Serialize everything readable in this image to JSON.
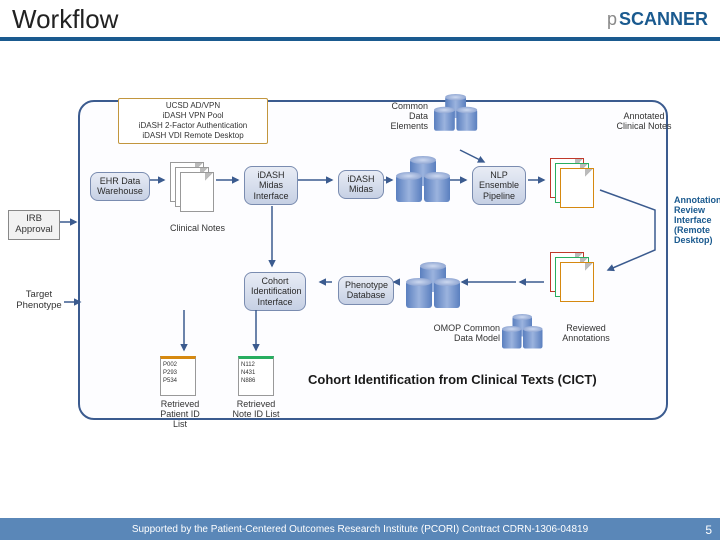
{
  "header": {
    "title": "Workflow",
    "logo_text": "SCANNER",
    "logo_prefix": "p"
  },
  "auth": {
    "line1": "UCSD AD/VPN",
    "line2": "iDASH VPN Pool",
    "line3": "iDASH 2-Factor Authentication",
    "line4": "iDASH VDI Remote Desktop"
  },
  "nodes": {
    "ehr": "EHR Data\nWarehouse",
    "midas_iface": "iDASH\nMidas\nInterface",
    "midas": "iDASH\nMidas",
    "cohort_iface": "Cohort\nIdentification\nInterface",
    "pheno_db": "Phenotype\nDatabase",
    "cde": "Common\nData\nElements",
    "nlp": "NLP\nEnsemble\nPipeline",
    "omop": "OMOP Common\nData Model"
  },
  "side_labels": {
    "irb": "IRB\nApproval",
    "target": "Target\nPhenotype",
    "clin_notes": "Clinical Notes",
    "annotated": "Annotated\nClinical Notes",
    "ann_review": "Annotation\nReview\nInterface\n(Remote\nDesktop)",
    "reviewed": "Reviewed\nAnnotations",
    "retr_patients": "Retrieved\nPatient ID List",
    "retr_notes": "Retrieved\nNote ID List"
  },
  "id_patients": {
    "p1": "P002",
    "p2": "P293",
    "p3": "P534"
  },
  "id_notes": {
    "n1": "N112",
    "n2": "N431",
    "n3": "N886"
  },
  "cict": "Cohort Identification from Clinical Texts (CICT)",
  "footer": "Supported by the Patient-Centered Outcomes Research Institute (PCORI) Contract CDRN-1306-04819",
  "page": "5"
}
